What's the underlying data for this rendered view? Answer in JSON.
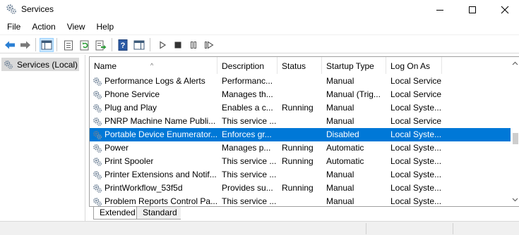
{
  "window": {
    "title": "Services",
    "icon": "services-gear-icon"
  },
  "menu": [
    "File",
    "Action",
    "View",
    "Help"
  ],
  "tree": {
    "root_label": "Services (Local)"
  },
  "table": {
    "columns": [
      "Name",
      "Description",
      "Status",
      "Startup Type",
      "Log On As"
    ],
    "sort_column": "Name",
    "rows": [
      {
        "name": "Performance Logs & Alerts",
        "description": "Performanc...",
        "status": "",
        "startup": "Manual",
        "logon": "Local Service"
      },
      {
        "name": "Phone Service",
        "description": "Manages th...",
        "status": "",
        "startup": "Manual (Trig...",
        "logon": "Local Service"
      },
      {
        "name": "Plug and Play",
        "description": "Enables a c...",
        "status": "Running",
        "startup": "Manual",
        "logon": "Local Syste..."
      },
      {
        "name": "PNRP Machine Name Publi...",
        "description": "This service ...",
        "status": "",
        "startup": "Manual",
        "logon": "Local Service"
      },
      {
        "name": "Portable Device Enumerator...",
        "description": "Enforces gr...",
        "status": "",
        "startup": "Disabled",
        "logon": "Local Syste...",
        "selected": true
      },
      {
        "name": "Power",
        "description": "Manages p...",
        "status": "Running",
        "startup": "Automatic",
        "logon": "Local Syste..."
      },
      {
        "name": "Print Spooler",
        "description": "This service ...",
        "status": "Running",
        "startup": "Automatic",
        "logon": "Local Syste..."
      },
      {
        "name": "Printer Extensions and Notif...",
        "description": "This service ...",
        "status": "",
        "startup": "Manual",
        "logon": "Local Syste..."
      },
      {
        "name": "PrintWorkflow_53f5d",
        "description": "Provides su...",
        "status": "Running",
        "startup": "Manual",
        "logon": "Local Syste..."
      },
      {
        "name": "Problem Reports Control Pa...",
        "description": "This service ...",
        "status": "",
        "startup": "Manual",
        "logon": "Local Syste..."
      }
    ]
  },
  "tabs": [
    "Extended",
    "Standard"
  ],
  "active_tab": "Extended",
  "colors": {
    "selection": "#0078d7",
    "tree_selection": "#d9d9d9",
    "toolbar_selected": "#cce8ff"
  }
}
